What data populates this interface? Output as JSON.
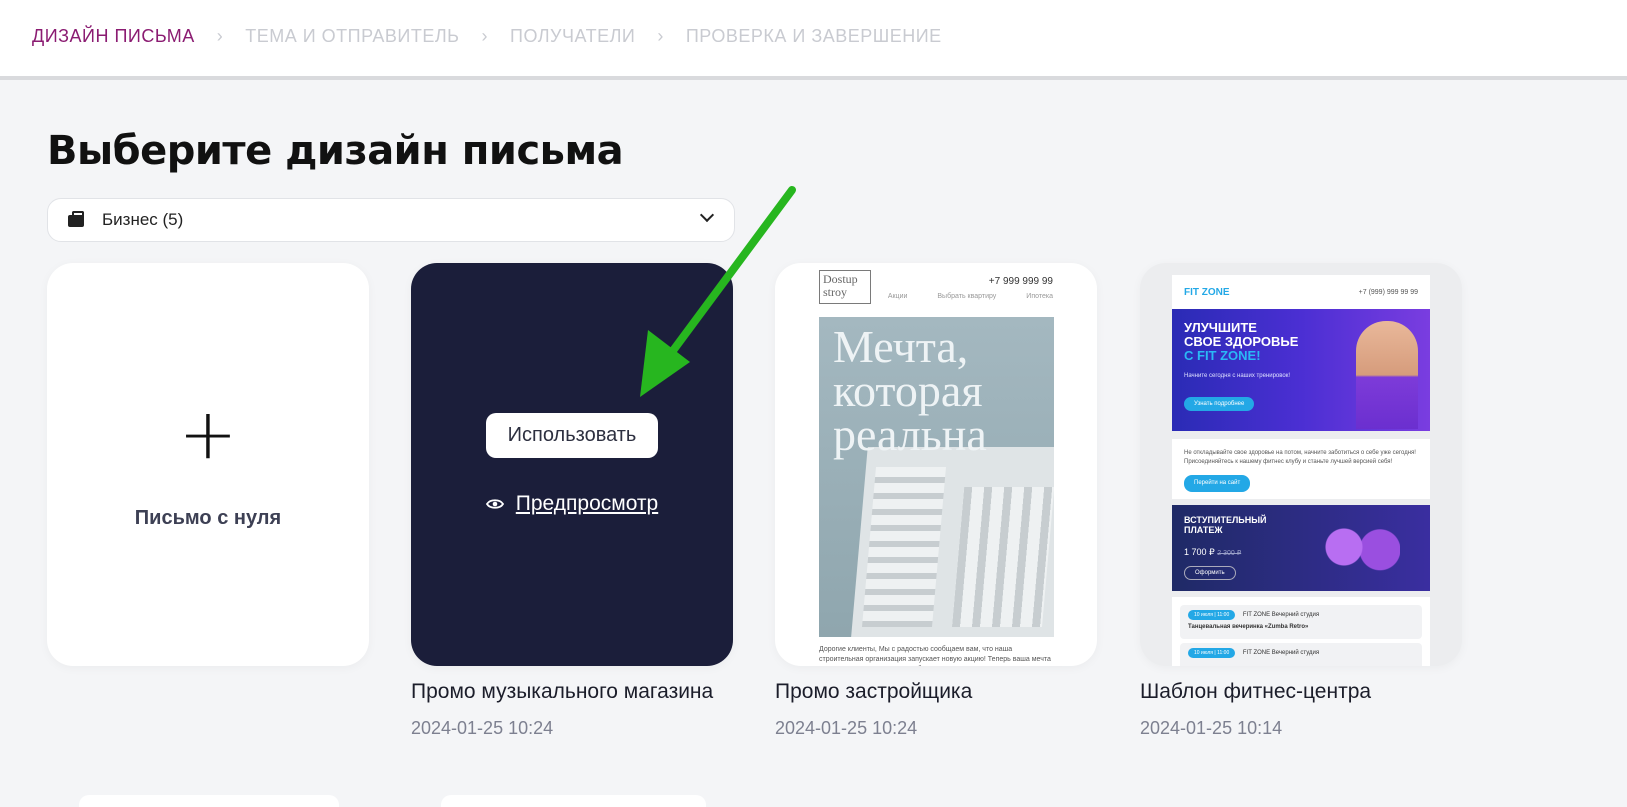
{
  "steps": {
    "s1": "ДИЗАЙН ПИСЬМА",
    "s2": "ТЕМА И ОТПРАВИТЕЛЬ",
    "s3": "ПОЛУЧАТЕЛИ",
    "s4": "ПРОВЕРКА И ЗАВЕРШЕНИЕ"
  },
  "page_title": "Выберите дизайн письма",
  "category_select": {
    "value": "Бизнес (5)",
    "icon": "briefcase-icon"
  },
  "blank_card": {
    "icon": "+",
    "label": "Письмо с нуля"
  },
  "cards": [
    {
      "name": "Промо музыкального магазина",
      "date": "2024-01-25 10:24",
      "use_label": "Использовать",
      "preview_label": "Предпросмотр"
    },
    {
      "name": "Промо застройщика",
      "date": "2024-01-25 10:24",
      "preview": {
        "logo": "Dostup stroy",
        "phone": "+7 999 999 99",
        "nav": [
          "Акции",
          "Выбрать квартиру",
          "Ипотека"
        ],
        "hero_text": "Мечта, которая реальна",
        "footer": "Дорогие клиенты, Мы с радостью сообщаем вам, что наша строительная организация запускает новую акцию! Теперь ваша мечта о идеальном доме стала еще ближе, чем"
      }
    },
    {
      "name": "Шаблон фитнес-центра",
      "date": "2024-01-25 10:14",
      "preview": {
        "logo": "FIT ZONE",
        "phone": "+7 (999) 999 99 99",
        "hero_l1": "УЛУЧШИТЕ",
        "hero_l2": "СВОЕ ЗДОРОВЬЕ",
        "hero_l3": "С FIT ZONE!",
        "hero_sub": "Начните сегодня с наших тренировок!",
        "hero_btn": "Узнать подробнее",
        "text": "Не откладывайте свое здоровье на потом, начните заботиться о себе уже сегодня! Присоединяйтесь к нашему фитнес клубу и станьте лучшей версией себя!",
        "text_btn": "Перейти на сайт",
        "promo_title": "ВСТУПИТЕЛЬНЫЙ ПЛАТЕЖ",
        "promo_price": "1 700 ₽",
        "promo_old": "2 300 ₽",
        "promo_btn": "Оформить",
        "row1_tag": "10 июля | 11:00",
        "row1_place": "FIT ZONE Вечерний студия",
        "row1_title": "Танцевальная вечеринка «Zumba Retro»",
        "row2_tag": "10 июля | 11:00",
        "row2_place": "FIT ZONE Вечерний студия"
      }
    }
  ],
  "colors": {
    "accent": "#8b1c72",
    "dark_card": "#1b1e3a",
    "arrow": "#27b61f"
  }
}
